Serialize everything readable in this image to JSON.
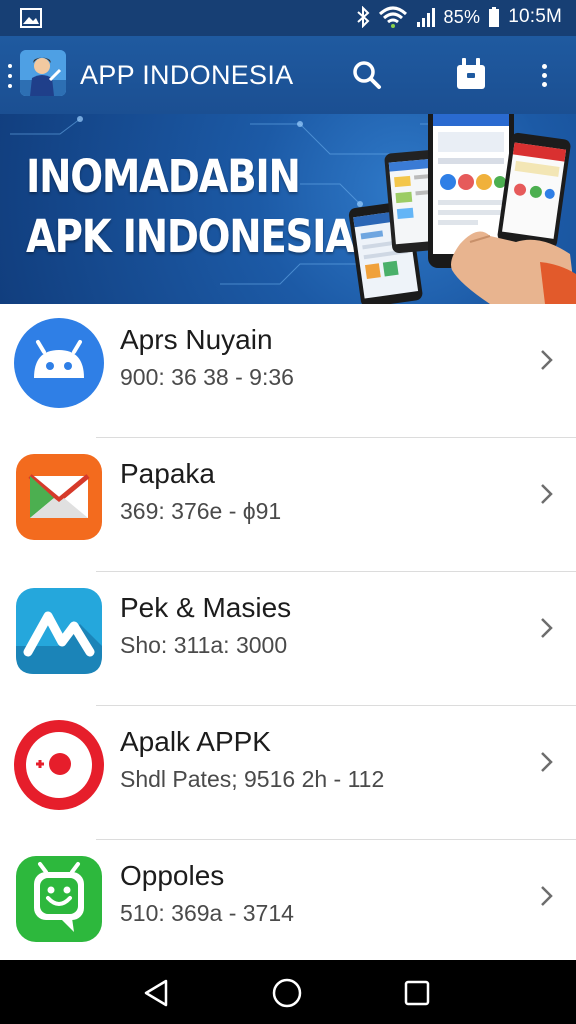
{
  "status_bar": {
    "gallery_icon": "image-icon",
    "bluetooth_icon": "bluetooth-icon",
    "wifi_icon": "wifi-icon",
    "signal_icon": "signal-icon",
    "battery_text": "85%",
    "battery_icon": "battery-icon",
    "time": "10:5M"
  },
  "app_bar": {
    "title": "APP INDONESIA",
    "background": "#1f5aa0",
    "icons": [
      "drag-handle-icon",
      "app-logo",
      "search-icon",
      "robot-icon",
      "more-vert-icon"
    ]
  },
  "banner": {
    "line1": "INOMADABIN",
    "line2": "APK INDONESIA"
  },
  "apps": [
    {
      "name": "Aprs Nuyain",
      "meta": "900: 36 38 - 9:36",
      "icon": "android-robot-icon",
      "color": "#2f7fe6"
    },
    {
      "name": "Papaka",
      "meta": "369: 376e - ϕ91",
      "icon": "envelope-icon",
      "color": "#f36b1e"
    },
    {
      "name": "Pek &  Masies",
      "meta": "Sho: 311a: 3000",
      "icon": "mountain-icon",
      "color": "#25a7dc"
    },
    {
      "name": "Apalk APPK",
      "meta": "Shdl Pates; 9516 2h - 112",
      "icon": "target-icon",
      "color": "#e61e2b"
    },
    {
      "name": "Oppoles",
      "meta": "510: 369a - 3714",
      "icon": "smiley-android-icon",
      "color": "#2db83d"
    }
  ],
  "nav_bar": {
    "back": "back-icon",
    "home": "home-icon",
    "recents": "recents-icon"
  }
}
